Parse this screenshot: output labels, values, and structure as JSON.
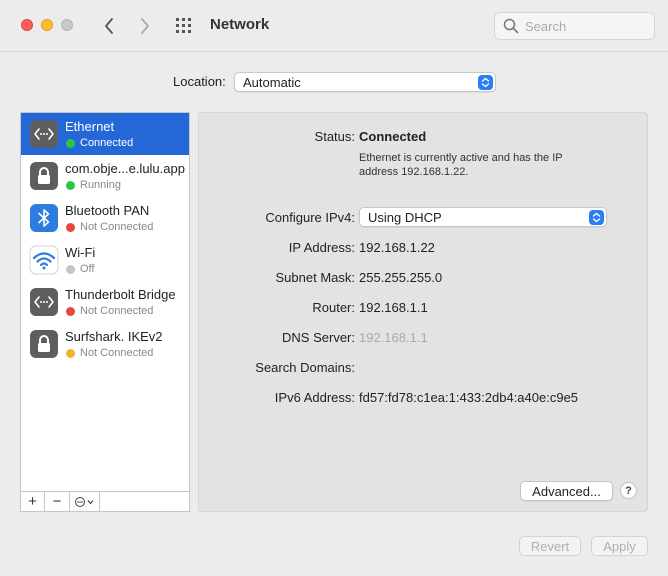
{
  "window": {
    "title": "Network",
    "search_placeholder": "Search"
  },
  "location": {
    "label": "Location:",
    "value": "Automatic"
  },
  "services": [
    {
      "name": "Ethernet",
      "status": "Connected",
      "status_color": "#28c840",
      "icon": "ethernet-icon",
      "selected": true
    },
    {
      "name": "com.obje...e.lulu.app",
      "status": "Running",
      "status_color": "#28c840",
      "icon": "lock-icon",
      "selected": false
    },
    {
      "name": "Bluetooth PAN",
      "status": "Not Connected",
      "status_color": "#e8453c",
      "icon": "bluetooth-icon",
      "selected": false
    },
    {
      "name": "Wi-Fi",
      "status": "Off",
      "status_color": "#c4c4c4",
      "icon": "wifi-icon",
      "selected": false
    },
    {
      "name": "Thunderbolt Bridge",
      "status": "Not Connected",
      "status_color": "#e8453c",
      "icon": "ethernet-icon",
      "selected": false
    },
    {
      "name": "Surfshark. IKEv2",
      "status": "Not Connected",
      "status_color": "#f2b32a",
      "icon": "lock-icon",
      "selected": false
    }
  ],
  "sidebar_tools": {
    "add": "+",
    "remove": "−"
  },
  "detail": {
    "status_label": "Status:",
    "status_value": "Connected",
    "status_description": "Ethernet is currently active and has the IP address 192.168.1.22.",
    "configure_label": "Configure IPv4:",
    "configure_value": "Using DHCP",
    "ip_label": "IP Address:",
    "ip_value": "192.168.1.22",
    "subnet_label": "Subnet Mask:",
    "subnet_value": "255.255.255.0",
    "router_label": "Router:",
    "router_value": "192.168.1.1",
    "dns_label": "DNS Server:",
    "dns_value": "192.168.1.1",
    "search_domains_label": "Search Domains:",
    "ipv6_label": "IPv6 Address:",
    "ipv6_value": "fd57:fd78:c1ea:1:433:2db4:a40e:c9e5",
    "advanced_button": "Advanced...",
    "help_button": "?"
  },
  "footer": {
    "revert_button": "Revert",
    "apply_button": "Apply"
  },
  "colors": {
    "accent": "#2467d6",
    "stepper": "#2a7ef2"
  }
}
